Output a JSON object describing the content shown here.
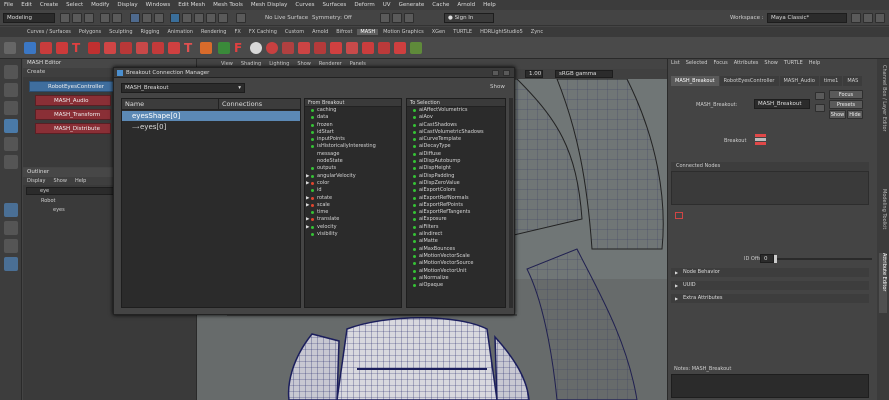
{
  "menubar": [
    "File",
    "Edit",
    "Create",
    "Select",
    "Modify",
    "Display",
    "Windows",
    "Edit Mesh",
    "Mesh Tools",
    "Mesh Display",
    "Curves",
    "Surfaces",
    "Deform",
    "UV",
    "Generate",
    "Cache",
    "Arnold",
    "Help"
  ],
  "status": {
    "mode": "Modeling",
    "live_surface": "No Live Surface",
    "symmetry": "Symmetry: Off",
    "sign_in": "Sign In",
    "workspace_label": "Workspace :",
    "workspace_value": "Maya Classic*"
  },
  "shelf_tabs": [
    "Curves / Surfaces",
    "Polygons",
    "Sculpting",
    "Rigging",
    "Animation",
    "Rendering",
    "FX",
    "FX Caching",
    "Custom",
    "Arnold",
    "Bifrost",
    "MASH",
    "Motion Graphics",
    "XGen",
    "TURTLE",
    "HDRLightStudio5",
    "Zync"
  ],
  "shelf_active": "MASH",
  "mash_editor": {
    "title": "MASH Editor",
    "menu": "Create",
    "nodes": [
      "RobotEyesController",
      "MASH_Audio",
      "MASH_Transform",
      "MASH_Distribute"
    ]
  },
  "outliner": {
    "title": "Outliner",
    "menu": [
      "Display",
      "Show",
      "Help"
    ],
    "search": "eye",
    "items": [
      "Robot",
      "eyes"
    ]
  },
  "viewport": {
    "menu": [
      "View",
      "Shading",
      "Lighting",
      "Show",
      "Renderer",
      "Panels"
    ],
    "value": "1.00",
    "colorspace": "sRGB gamma"
  },
  "dialog": {
    "title": "Breakout Connection Manager",
    "node_select": "MASH_Breakout",
    "show_label": "Show",
    "columns": {
      "name": "Name",
      "connections": "Connections"
    },
    "tree": [
      {
        "label": "eyesShape[0]",
        "selected": true
      },
      {
        "label": "eyes[0]",
        "selected": false
      }
    ],
    "from_title": "From Breakout",
    "from_items": [
      {
        "label": "caching",
        "arrow": false,
        "color": "#35c235"
      },
      {
        "label": "data",
        "arrow": false,
        "color": "#35c235"
      },
      {
        "label": "frozen",
        "arrow": false,
        "color": "#35c235"
      },
      {
        "label": "idStart",
        "arrow": false,
        "color": "#35c235"
      },
      {
        "label": "inputPoints",
        "arrow": false,
        "color": "#35c235"
      },
      {
        "label": "isHistoricallyInteresting",
        "arrow": false,
        "color": "#35c235"
      },
      {
        "label": "message",
        "arrow": false,
        "color": ""
      },
      {
        "label": "nodeState",
        "arrow": false,
        "color": ""
      },
      {
        "label": "outputs",
        "arrow": false,
        "color": "#35c235"
      },
      {
        "label": "angularVelocity",
        "arrow": true,
        "color": "#35c235"
      },
      {
        "label": "color",
        "arrow": true,
        "color": "#e0452f"
      },
      {
        "label": "id",
        "arrow": false,
        "color": "#35c235"
      },
      {
        "label": "rotate",
        "arrow": true,
        "color": "#e0452f"
      },
      {
        "label": "scale",
        "arrow": true,
        "color": "#e0452f"
      },
      {
        "label": "time",
        "arrow": false,
        "color": "#35c235"
      },
      {
        "label": "translate",
        "arrow": true,
        "color": "#e0452f"
      },
      {
        "label": "velocity",
        "arrow": true,
        "color": "#35c235"
      },
      {
        "label": "visibility",
        "arrow": false,
        "color": "#35c235"
      }
    ],
    "to_title": "To Selection",
    "to_items": [
      "aiAffectVolumetrics",
      "aiAov",
      "aiCastShadows",
      "aiCastVolumetricShadows",
      "aiCurveTemplate",
      "aiDecayType",
      "aiDiffuse",
      "aiDispAutobump",
      "aiDispHeight",
      "aiDispPadding",
      "aiDispZeroValue",
      "aiExportColors",
      "aiExportRefNormals",
      "aiExportRefPoints",
      "aiExportRefTangents",
      "aiExposure",
      "aiFilters",
      "aiIndirect",
      "aiMatte",
      "aiMaxBounces",
      "aiMotionVectorScale",
      "aiMotionVectorSource",
      "aiMotionVectorUnit",
      "aiNormalize",
      "aiOpaque"
    ]
  },
  "attribute_editor": {
    "menu": [
      "List",
      "Selected",
      "Focus",
      "Attributes",
      "Show",
      "TURTLE",
      "Help"
    ],
    "tabs": [
      "MASH_Breakout",
      "RobotEyesController",
      "MASH_Audio",
      "time1",
      "MAS"
    ],
    "field_label": "MASH_Breakout:",
    "field_value": "MASH_Breakout",
    "buttons": {
      "focus": "Focus",
      "presets": "Presets",
      "show": "Show",
      "hide": "Hide"
    },
    "breakout_label": "Breakout",
    "connected_nodes": "Connected Nodes",
    "id_offset_label": "ID Offset",
    "id_offset_value": "0",
    "sections": [
      "Node Behavior",
      "UUID",
      "Extra Attributes"
    ],
    "notes": "Notes:  MASH_Breakout"
  },
  "side_tabs": [
    "Channel Box / Layer Editor",
    "Modeling Toolkit",
    "Attribute Editor"
  ]
}
